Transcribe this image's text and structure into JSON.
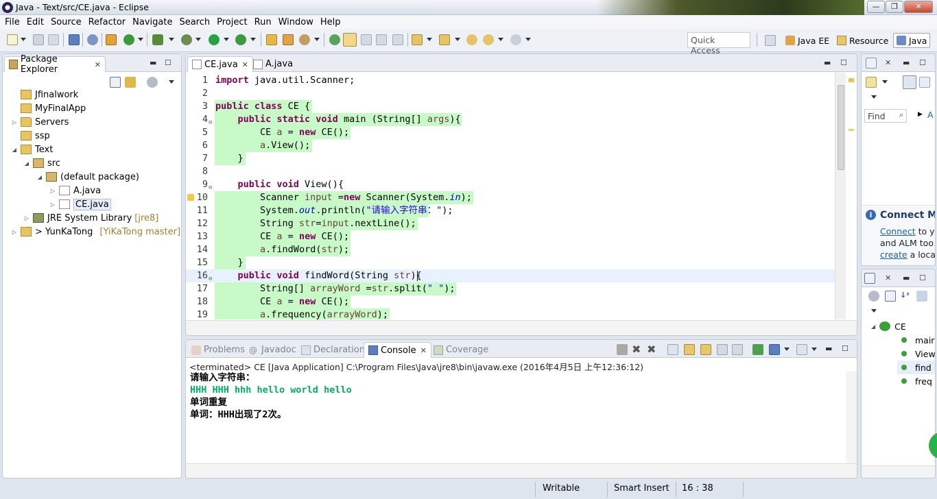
{
  "window": {
    "title": "Java - Text/src/CE.java - Eclipse",
    "min": "—",
    "max": "❐",
    "close": "✕"
  },
  "menu": [
    "File",
    "Edit",
    "Source",
    "Refactor",
    "Navigate",
    "Search",
    "Project",
    "Run",
    "Window",
    "Help"
  ],
  "toolbar": {
    "quick_access_placeholder": "Quick Access"
  },
  "perspectives": [
    {
      "label": "Java EE",
      "active": false
    },
    {
      "label": "Resource",
      "active": false
    },
    {
      "label": "Java",
      "active": true
    }
  ],
  "package_explorer": {
    "title": "Package Explorer",
    "items": [
      {
        "label": "Jfinalwork",
        "decoration": "",
        "expander": ""
      },
      {
        "label": "MyFinalApp",
        "decoration": "",
        "expander": ""
      },
      {
        "label": "Servers",
        "decoration": "",
        "expander": "▷"
      },
      {
        "label": "ssp",
        "decoration": "",
        "expander": ""
      },
      {
        "label": "Text",
        "decoration": "",
        "expander": "◢"
      },
      {
        "label": "src",
        "decoration": "",
        "expander": "◢"
      },
      {
        "label": "(default package)",
        "decoration": "",
        "expander": "◢"
      },
      {
        "label": "A.java",
        "decoration": "",
        "expander": "▷"
      },
      {
        "label": "CE.java",
        "decoration": "",
        "expander": "▷"
      },
      {
        "label": "JRE System Library",
        "decoration": "[jre8]",
        "expander": "▷"
      },
      {
        "label": "> YunKaTong",
        "decoration": "[YiKaTong master]",
        "expander": "▷"
      }
    ]
  },
  "editor": {
    "tabs": [
      {
        "label": "CE.java",
        "active": true
      },
      {
        "label": "A.java",
        "active": false
      }
    ],
    "current_line": 16
  },
  "console_tabs": [
    {
      "label": "Problems",
      "active": false
    },
    {
      "label": "Javadoc",
      "active": false
    },
    {
      "label": "Declaration",
      "active": false
    },
    {
      "label": "Console",
      "active": true
    },
    {
      "label": "Coverage",
      "active": false
    }
  ],
  "console": {
    "status": "<terminated> CE [Java Application] C:\\Program Files\\Java\\jre8\\bin\\javaw.exe (2016年4月5日 上午12:36:12)",
    "lines": [
      {
        "text": "请输入字符串：",
        "input": false
      },
      {
        "text": "HHH HHH hhh hello world hello",
        "input": true
      },
      {
        "text": "单词重复",
        "input": false
      },
      {
        "text": "单词：HHH出现了2次。",
        "input": false
      }
    ]
  },
  "task_pane": {
    "find_placeholder": "Find",
    "filter_label": "A",
    "mylyn_title": "Connect My",
    "mylyn_line1_link": "Connect",
    "mylyn_line1_rest": " to yo",
    "mylyn_line2": "and ALM too",
    "mylyn_line3_link": "create",
    "mylyn_line3_rest": " a local"
  },
  "outline": {
    "root": "CE",
    "members": [
      "mair",
      "View",
      "find",
      "freq"
    ]
  },
  "status_bar": {
    "writable": "Writable",
    "insert_mode": "Smart Insert",
    "position": "16 : 38"
  },
  "colors": {
    "hover_highlight": "#c8fac8",
    "keyword": "#7f0055",
    "string": "#2a00ff",
    "console_input": "#00b060"
  }
}
